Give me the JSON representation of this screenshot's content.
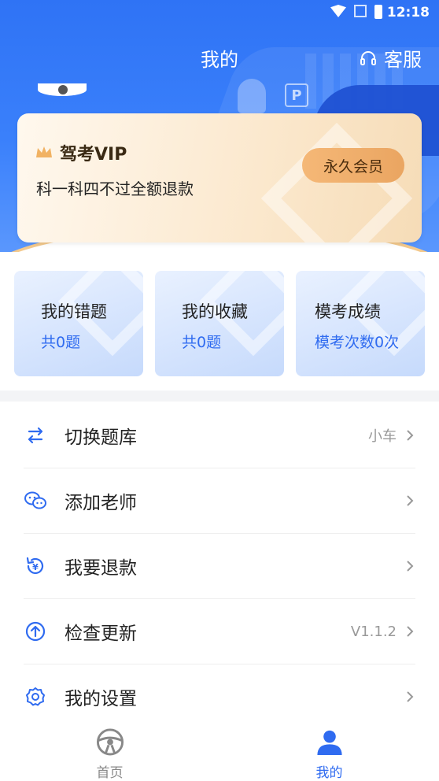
{
  "statusbar": {
    "time": "12:18"
  },
  "header": {
    "title": "我的",
    "service_label": "客服"
  },
  "vip": {
    "title": "驾考VIP",
    "desc": "科一科四不过全额退款",
    "badge": "永久会员"
  },
  "stats": [
    {
      "name": "我的错题",
      "value": "共0题"
    },
    {
      "name": "我的收藏",
      "value": "共0题"
    },
    {
      "name": "模考成绩",
      "value": "模考次数0次"
    }
  ],
  "menu": [
    {
      "label": "切换题库",
      "extra": "小车",
      "icon": "switch-icon"
    },
    {
      "label": "添加老师",
      "extra": "",
      "icon": "wechat-icon"
    },
    {
      "label": "我要退款",
      "extra": "",
      "icon": "refund-icon"
    },
    {
      "label": "检查更新",
      "extra": "V1.1.2",
      "icon": "update-icon"
    },
    {
      "label": "我的设置",
      "extra": "",
      "icon": "settings-icon"
    }
  ],
  "tabs": [
    {
      "label": "首页",
      "icon": "steering-wheel-icon"
    },
    {
      "label": "我的",
      "icon": "user-icon"
    }
  ],
  "colors": {
    "primary": "#2f6bf0",
    "vip_gold": "#f5b877"
  }
}
